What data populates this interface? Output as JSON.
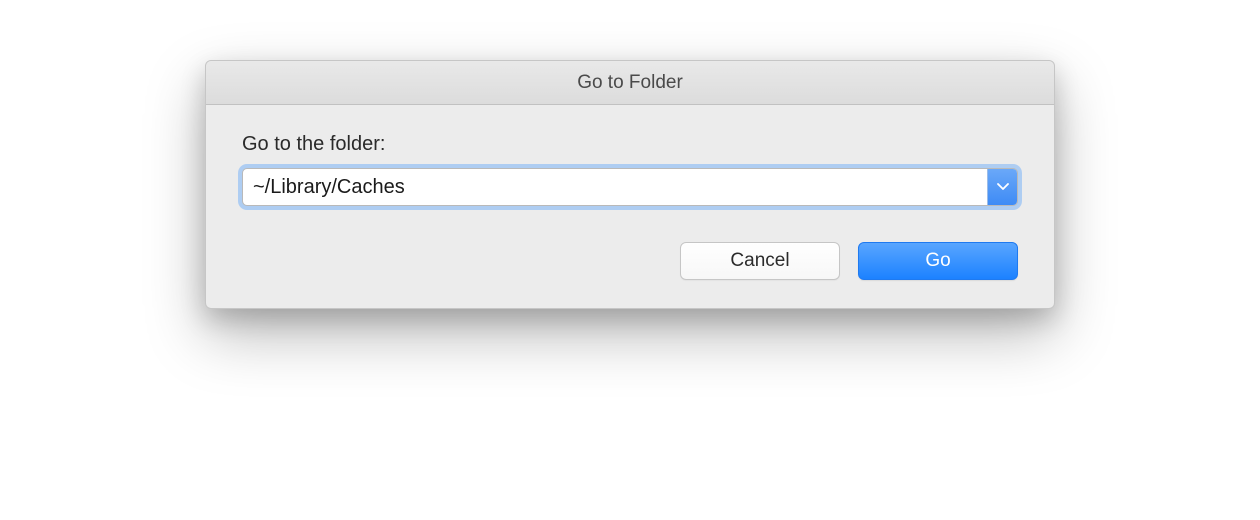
{
  "dialog": {
    "title": "Go to Folder",
    "prompt_label": "Go to the folder:",
    "path_input": {
      "value": "~/Library/Caches"
    },
    "buttons": {
      "cancel": "Cancel",
      "go": "Go"
    }
  }
}
